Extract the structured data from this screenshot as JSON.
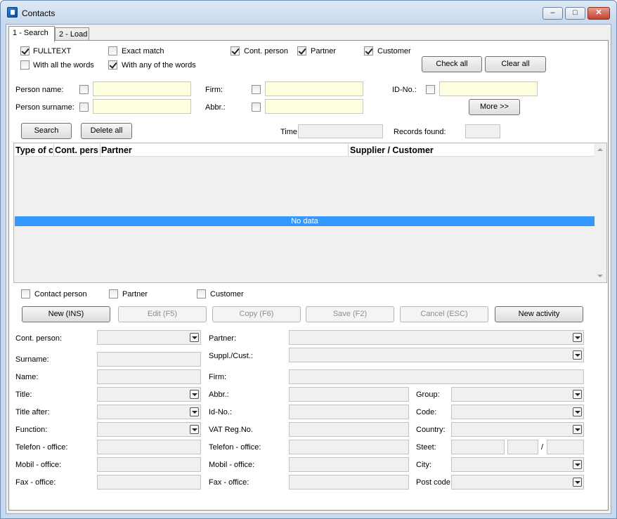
{
  "window": {
    "title": "Contacts",
    "min": "–",
    "max": "□",
    "close": "✕"
  },
  "tabs": [
    {
      "label": "1 - Search"
    },
    {
      "label": "2 - Load"
    }
  ],
  "search": {
    "fulltext": {
      "label": "FULLTEXT",
      "checked": true
    },
    "exact_match": {
      "label": "Exact match",
      "checked": false
    },
    "cont_person": {
      "label": "Cont. person",
      "checked": true
    },
    "partner": {
      "label": "Partner",
      "checked": true
    },
    "customer": {
      "label": "Customer",
      "checked": true
    },
    "with_all_words": {
      "label": "With all the words",
      "checked": false
    },
    "with_any_words": {
      "label": "With any of the words",
      "checked": true
    },
    "check_all": "Check all",
    "clear_all": "Clear all",
    "person_name": "Person name:",
    "person_surname": "Person surname:",
    "firm": "Firm:",
    "abbr": "Abbr.:",
    "id_no": "ID-No.:",
    "more": "More >>",
    "search_btn": "Search",
    "delete_all": "Delete all",
    "time": "Time",
    "records_found": "Records found:"
  },
  "grid": {
    "columns": [
      "Type of c",
      "Cont. pers",
      "Partner",
      "Supplier / Customer"
    ],
    "no_data": "No data"
  },
  "filters": {
    "contact_person": "Contact person",
    "partner": "Partner",
    "customer": "Customer"
  },
  "actions": {
    "new": "New (INS)",
    "edit": "Edit (F5)",
    "copy": "Copy (F6)",
    "save": "Save (F2)",
    "cancel": "Cancel (ESC)",
    "new_activity": "New activity"
  },
  "form": {
    "cont_person": "Cont. person:",
    "surname": "Surname:",
    "name": "Name:",
    "title": "Title:",
    "title_after": "Title after:",
    "function": "Function:",
    "telefon_office": "Telefon - office:",
    "mobil_office": "Mobil - office:",
    "fax_office": "Fax - office:",
    "partner": "Partner:",
    "suppl_cust": "Suppl./Cust.:",
    "firm": "Firm:",
    "abbr": "Abbr.:",
    "id_no": "Id-No.:",
    "vat": "VAT Reg.No.",
    "telefon_office2": "Telefon - office:",
    "mobil_office2": "Mobil - office:",
    "fax_office2": "Fax - office:",
    "group": "Group:",
    "code": "Code:",
    "country": "Country:",
    "steet": "Steet:",
    "city": "City:",
    "post_code": "Post code:",
    "slash": "/"
  }
}
